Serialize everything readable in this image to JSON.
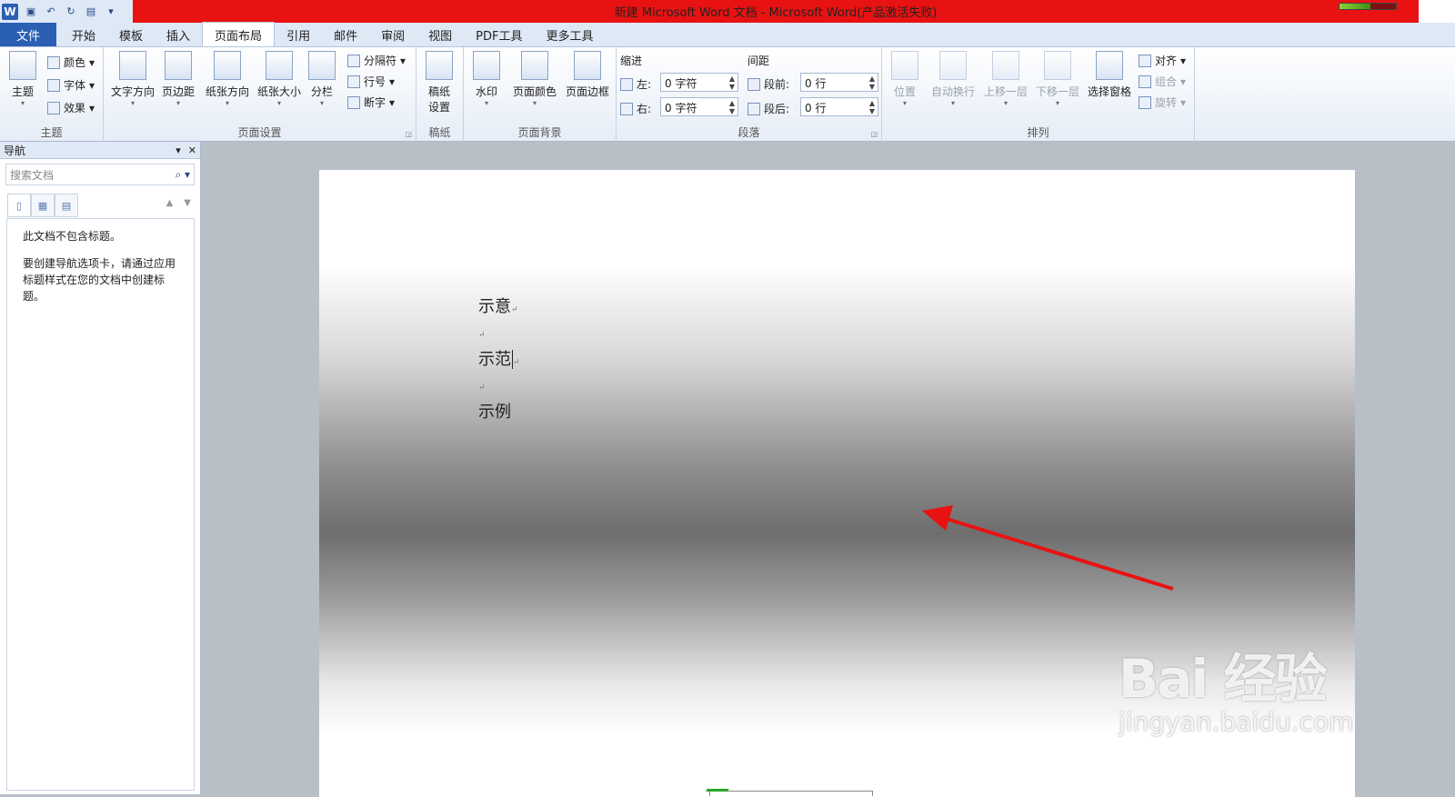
{
  "window": {
    "title": "新建 Microsoft Word 文档 - Microsoft Word(产品激活失败)",
    "qat_items": [
      "word-logo",
      "save-icon",
      "undo-icon",
      "redo-icon",
      "print-preview-icon",
      "customize-icon"
    ]
  },
  "tabs": [
    "文件",
    "开始",
    "模板",
    "插入",
    "页面布局",
    "引用",
    "邮件",
    "审阅",
    "视图",
    "PDF工具",
    "更多工具"
  ],
  "active_tab": "页面布局",
  "ribbon": {
    "theme": {
      "label": "主题",
      "big": "主题",
      "colors": "颜色",
      "fonts": "字体",
      "effects": "效果"
    },
    "page_setup": {
      "label": "页面设置",
      "text_direction": "文字方向",
      "margins": "页边距",
      "orientation": "纸张方向",
      "size": "纸张大小",
      "columns": "分栏",
      "breaks": "分隔符",
      "line_numbers": "行号",
      "hyphenation": "断字"
    },
    "draft": {
      "label": "稿纸",
      "settings": "稿纸\n设置",
      "settings_a": "稿纸",
      "settings_b": "设置"
    },
    "page_background": {
      "label": "页面背景",
      "watermark": "水印",
      "page_color": "页面颜色",
      "page_borders": "页面边框"
    },
    "paragraph": {
      "label": "段落",
      "indent": "缩进",
      "left": "左:",
      "right": "右:",
      "left_val": "0 字符",
      "right_val": "0 字符",
      "spacing": "间距",
      "before": "段前:",
      "after": "段后:",
      "before_val": "0 行",
      "after_val": "0 行"
    },
    "arrange": {
      "label": "排列",
      "position": "位置",
      "wrap": "自动换行",
      "forward": "上移一层",
      "backward": "下移一层",
      "selection_pane": "选择窗格",
      "align": "对齐",
      "group": "组合",
      "rotate": "旋转"
    }
  },
  "nav": {
    "title": "导航",
    "search_placeholder": "搜索文档",
    "no_headings": "此文档不包含标题。",
    "help": "要创建导航选项卡，请通过应用标题样式在您的文档中创建标题。"
  },
  "document": {
    "lines": [
      "示意",
      "示范",
      "示例"
    ]
  },
  "watermark": {
    "brand": "Bai 经验",
    "url": "jingyan.baidu.com"
  },
  "colors": {
    "title_bar": "#e81212",
    "file_tab": "#2b5fb4",
    "arrow": "#e81212"
  }
}
